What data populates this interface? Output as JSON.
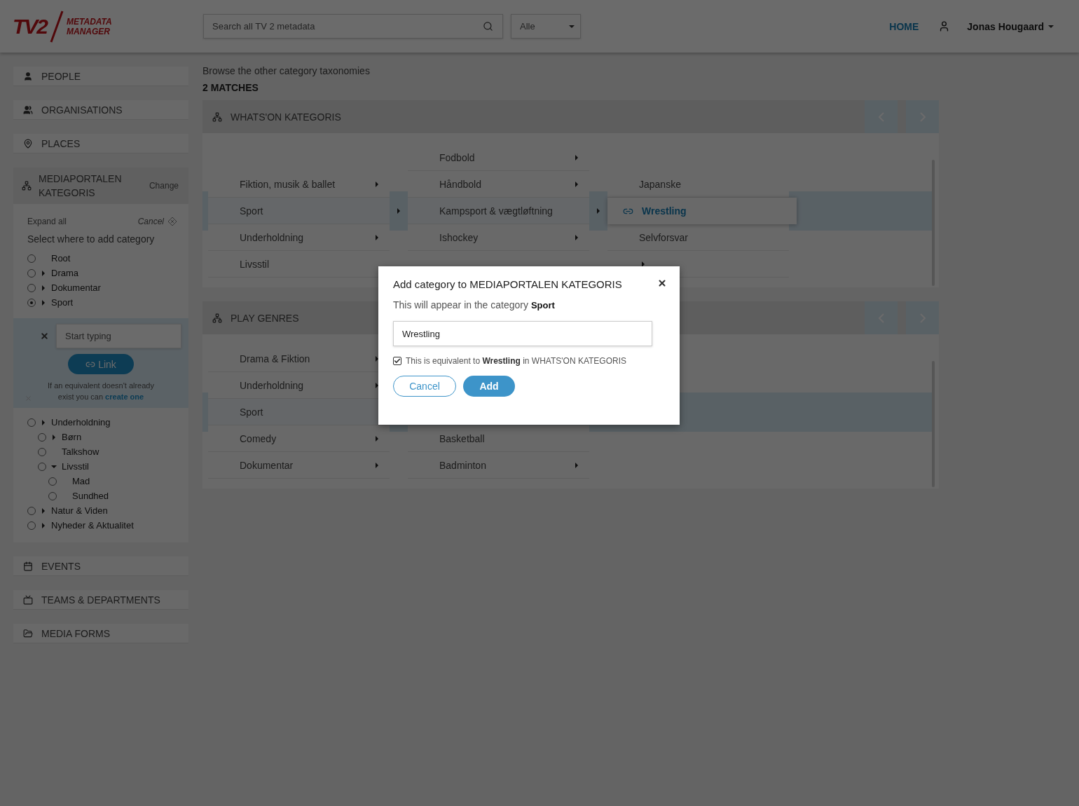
{
  "header": {
    "logo": {
      "mark": "TV2",
      "line1": "METADATA",
      "line2": "MANAGER"
    },
    "search": {
      "placeholder": "Search all TV 2 metadata"
    },
    "filter": {
      "value": "Alle"
    },
    "home_link": "HOME",
    "user": "Jonas Hougaard"
  },
  "sidebar": {
    "top_items": [
      {
        "label": "PEOPLE"
      },
      {
        "label": "ORGANISATIONS"
      },
      {
        "label": "PLACES"
      }
    ],
    "taxonomy": {
      "title": "MEDIAPORTALEN KATEGORIS",
      "change": "Change",
      "expand_all": "Expand all",
      "cancel": "Cancel",
      "prompt": "Select where to add category",
      "tree_before": [
        {
          "label": "Root",
          "kind": "leaf",
          "selected": false
        },
        {
          "label": "Drama",
          "kind": "collapsed",
          "selected": false
        },
        {
          "label": "Dokumentar",
          "kind": "collapsed",
          "selected": false
        },
        {
          "label": "Sport",
          "kind": "collapsed",
          "selected": true
        }
      ],
      "link_form": {
        "placeholder": "Start typing",
        "button": "Link",
        "hint": "If an equivalent doesn't already exist you can",
        "hint_link": "create one"
      },
      "tree_after": [
        {
          "label": "Underholdning",
          "kind": "collapsed",
          "selected": false,
          "children": [
            {
              "label": "Børn",
              "kind": "collapsed",
              "selected": false
            },
            {
              "label": "Talkshow",
              "kind": "leaf",
              "selected": false
            },
            {
              "label": "Livsstil",
              "kind": "expanded",
              "selected": false,
              "children": [
                {
                  "label": "Mad",
                  "kind": "leaf",
                  "selected": false
                },
                {
                  "label": "Sundhed",
                  "kind": "leaf",
                  "selected": false
                }
              ]
            }
          ]
        },
        {
          "label": "Natur & Viden",
          "kind": "collapsed",
          "selected": false
        },
        {
          "label": "Nyheder & Aktualitet",
          "kind": "collapsed",
          "selected": false
        }
      ]
    },
    "bottom_items": [
      {
        "label": "EVENTS"
      },
      {
        "label": "TEAMS & DEPARTMENTS"
      },
      {
        "label": "MEDIA FORMS"
      }
    ]
  },
  "main": {
    "intro": "Browse the other category taxonomies",
    "matches": "2 MATCHES",
    "panels": [
      {
        "title": "WHATS'ON KATEGORIS",
        "columns": [
          [
            {
              "label": "Fiktion, musik & ballet",
              "has_children": true,
              "selected": false
            },
            {
              "label": "Sport",
              "has_children": true,
              "selected": true
            },
            {
              "label": "Underholdning",
              "has_children": true,
              "selected": false
            },
            {
              "label": "Livsstil",
              "has_children": false,
              "selected": false
            }
          ],
          [
            {
              "label": "Fodbold",
              "has_children": true,
              "selected": false
            },
            {
              "label": "Håndbold",
              "has_children": true,
              "selected": false
            },
            {
              "label": "Kampsport & vægtløftning",
              "has_children": true,
              "selected": true
            },
            {
              "label": "Ishockey",
              "has_children": true,
              "selected": false
            }
          ],
          [
            {
              "label": "Japanske",
              "has_children": false,
              "selected": false
            },
            {
              "label": "Wrestling",
              "kind": "new",
              "selected": true
            },
            {
              "label": "Selvforsvar",
              "has_children": false,
              "selected": false
            },
            {
              "has_children": true,
              "selected": false
            }
          ]
        ]
      },
      {
        "title": "PLAY GENRES",
        "columns": [
          [
            {
              "label": "Drama & Fiktion",
              "has_children": true,
              "selected": false
            },
            {
              "label": "Underholdning",
              "has_children": true,
              "selected": false
            },
            {
              "label": "Sport",
              "has_children": true,
              "selected": true
            },
            {
              "label": "Comedy",
              "has_children": true,
              "selected": false
            },
            {
              "label": "Dokumentar",
              "has_children": true,
              "selected": false
            }
          ],
          [
            {
              "label": "Basketball",
              "has_children": false,
              "selected": false
            },
            {
              "label": "Badminton",
              "has_children": true,
              "selected": false
            }
          ]
        ]
      }
    ]
  },
  "dialog": {
    "title": "Add category to MEDIAPORTALEN KATEGORIS",
    "subtitle": "This will appear in the category **Sport**",
    "value": "Wrestling",
    "equivalent": {
      "checked": true,
      "text": "This is equivalent to **Wrestling** in WHATS'ON KATEGORIS"
    },
    "cancel": "Cancel",
    "add": "Add"
  }
}
